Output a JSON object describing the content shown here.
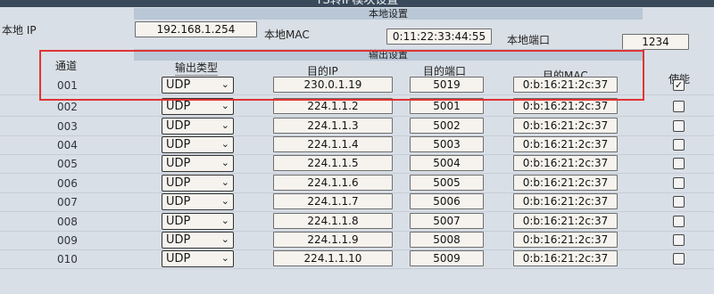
{
  "window": {
    "title": "TS转IP模块设置"
  },
  "local": {
    "header": "本地设置",
    "ip_label": "本地 IP",
    "ip_value": "192.168.1.254",
    "mac_label": "本地MAC",
    "mac_value": "0:11:22:33:44:55",
    "port_label": "本地端口",
    "port_value": "1234"
  },
  "output": {
    "header": "输出设置",
    "columns": {
      "channel": "通道",
      "type": "输出类型",
      "dest_ip": "目的IP",
      "dest_port": "目的端口",
      "dest_mac": "目的MAC",
      "enable": "使能"
    },
    "rows": [
      {
        "channel": "001",
        "type": "UDP",
        "dest_ip": "230.0.1.19",
        "dest_port": "5019",
        "dest_mac": "0:b:16:21:2c:37",
        "enabled": true
      },
      {
        "channel": "002",
        "type": "UDP",
        "dest_ip": "224.1.1.2",
        "dest_port": "5001",
        "dest_mac": "0:b:16:21:2c:37",
        "enabled": false
      },
      {
        "channel": "003",
        "type": "UDP",
        "dest_ip": "224.1.1.3",
        "dest_port": "5002",
        "dest_mac": "0:b:16:21:2c:37",
        "enabled": false
      },
      {
        "channel": "004",
        "type": "UDP",
        "dest_ip": "224.1.1.4",
        "dest_port": "5003",
        "dest_mac": "0:b:16:21:2c:37",
        "enabled": false
      },
      {
        "channel": "005",
        "type": "UDP",
        "dest_ip": "224.1.1.5",
        "dest_port": "5004",
        "dest_mac": "0:b:16:21:2c:37",
        "enabled": false
      },
      {
        "channel": "006",
        "type": "UDP",
        "dest_ip": "224.1.1.6",
        "dest_port": "5005",
        "dest_mac": "0:b:16:21:2c:37",
        "enabled": false
      },
      {
        "channel": "007",
        "type": "UDP",
        "dest_ip": "224.1.1.7",
        "dest_port": "5006",
        "dest_mac": "0:b:16:21:2c:37",
        "enabled": false
      },
      {
        "channel": "008",
        "type": "UDP",
        "dest_ip": "224.1.1.8",
        "dest_port": "5007",
        "dest_mac": "0:b:16:21:2c:37",
        "enabled": false
      },
      {
        "channel": "009",
        "type": "UDP",
        "dest_ip": "224.1.1.9",
        "dest_port": "5008",
        "dest_mac": "0:b:16:21:2c:37",
        "enabled": false
      },
      {
        "channel": "010",
        "type": "UDP",
        "dest_ip": "224.1.1.10",
        "dest_port": "5009",
        "dest_mac": "0:b:16:21:2c:37",
        "enabled": false
      }
    ]
  },
  "icons": {
    "dropdown": "chevron-down-icon",
    "checked": "check-icon"
  },
  "colors": {
    "highlight_box": "#e03434",
    "background": "#d9dfe6",
    "field": "#f6f3ee"
  }
}
